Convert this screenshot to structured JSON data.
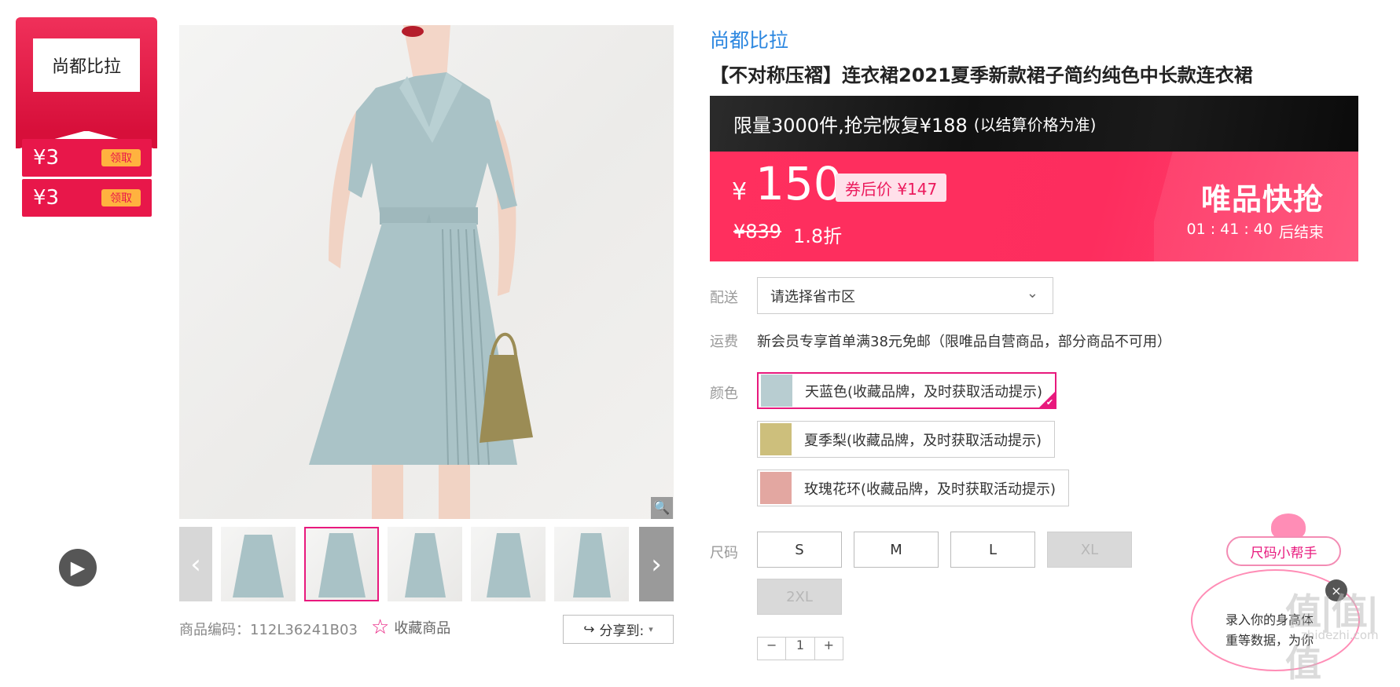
{
  "coupons": {
    "brand_logo": "尚都比拉",
    "items": [
      {
        "amount": "¥3",
        "action": "领取"
      },
      {
        "amount": "¥3",
        "action": "领取"
      }
    ]
  },
  "gallery": {
    "sku_label": "商品编码：",
    "sku_value": "112L36241B03",
    "favorite_label": "收藏商品",
    "share_label": "分享到:",
    "active_thumb_index": 2
  },
  "product": {
    "brand": "尚都比拉",
    "title": "【不对称压褶】连衣裙2021夏季新款裙子简约纯色中长款连衣裙"
  },
  "promo": {
    "main_text": "限量3000件,抢完恢复¥188",
    "note": "(以结算价格为准)"
  },
  "price": {
    "currency": "¥",
    "current": "150",
    "after_coupon": "券后价 ¥147",
    "original": "¥839",
    "discount": "1.8折",
    "flash_label": "唯品快抢",
    "countdown": "01 : 41 : 40",
    "countdown_suffix": "后结束"
  },
  "delivery": {
    "label": "配送",
    "placeholder": "请选择省市区"
  },
  "shipping": {
    "label": "运费",
    "text": "新会员专享首单满38元免邮（限唯品自营商品，部分商品不可用）"
  },
  "colors": {
    "label": "颜色",
    "options": [
      {
        "name": "天蓝色(收藏品牌，及时获取活动提示)",
        "selected": true,
        "swatch": "#b8cdd1"
      },
      {
        "name": "夏季梨(收藏品牌，及时获取活动提示)",
        "selected": false,
        "swatch": "#cdbf7c"
      },
      {
        "name": "玫瑰花环(收藏品牌，及时获取活动提示)",
        "selected": false,
        "swatch": "#e3a7a1"
      }
    ]
  },
  "sizes": {
    "label": "尺码",
    "options": [
      {
        "name": "S",
        "available": true
      },
      {
        "name": "M",
        "available": true
      },
      {
        "name": "L",
        "available": true
      },
      {
        "name": "XL",
        "available": false
      },
      {
        "name": "2XL",
        "available": false
      }
    ]
  },
  "quantity": {
    "value": "1"
  },
  "size_helper": {
    "button_label": "尺码小帮手",
    "bubble_line1": "录入你的身高体",
    "bubble_line2": "重等数据，为你"
  },
  "watermark": {
    "text": "值|值|值",
    "url": "zhidezhi.com"
  },
  "colors_theme": {
    "accent": "#e8197d",
    "price_bg": "#fd2d5e",
    "brand_link": "#2c87e0"
  }
}
